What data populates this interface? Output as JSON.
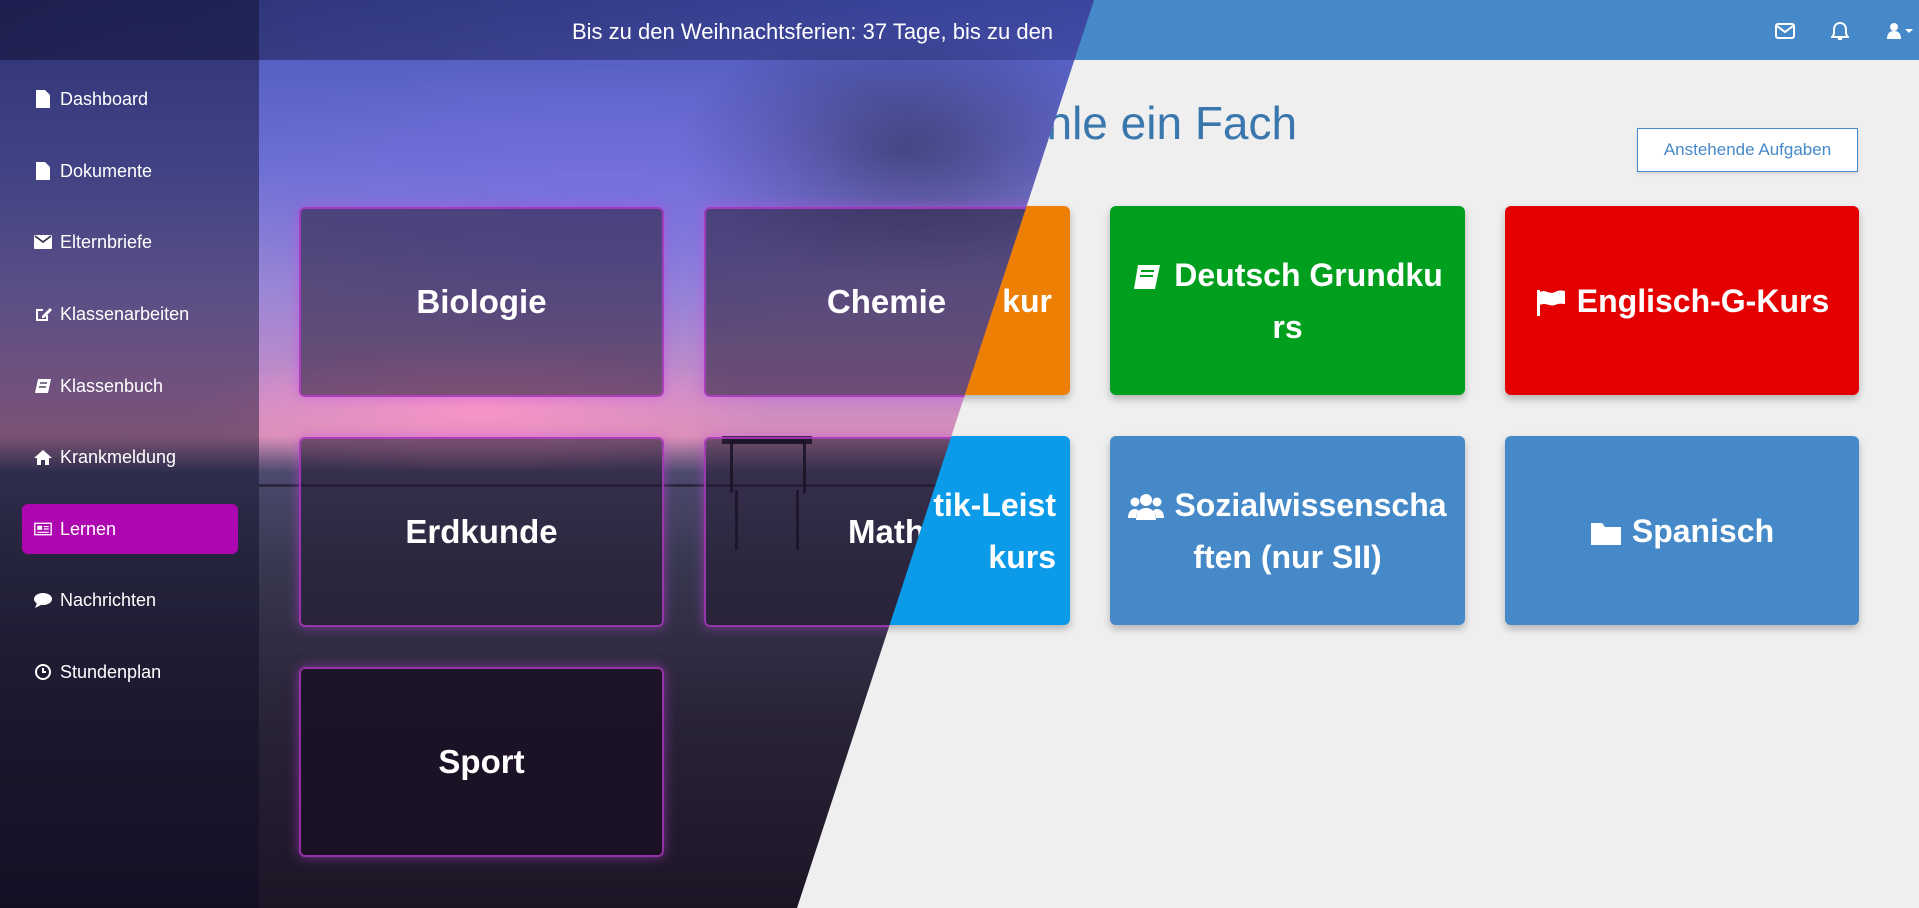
{
  "header": {
    "announcement": "Bis zu den Weihnachtsferien: 37 Tage, bis zu den"
  },
  "sidebar": {
    "items": [
      {
        "label": "Dashboard",
        "icon": "file-icon"
      },
      {
        "label": "Dokumente",
        "icon": "file-icon"
      },
      {
        "label": "Elternbriefe",
        "icon": "envelope-icon"
      },
      {
        "label": "Klassenarbeiten",
        "icon": "edit-icon"
      },
      {
        "label": "Klassenbuch",
        "icon": "book-icon"
      },
      {
        "label": "Krankmeldung",
        "icon": "home-icon"
      },
      {
        "label": "Lernen",
        "icon": "newspaper-icon",
        "active": true
      },
      {
        "label": "Nachrichten",
        "icon": "comment-icon"
      },
      {
        "label": "Stundenplan",
        "icon": "clock-icon"
      }
    ],
    "active_color": "#ae06b0"
  },
  "main": {
    "title": "Bitte wähle ein Fach",
    "tasks_button": "Anstehende Aufgaben"
  },
  "subjects_dark": [
    {
      "label": "Biologie"
    },
    {
      "label": "Chemie"
    },
    {
      "label": "Erdkunde"
    },
    {
      "label": "Math"
    },
    {
      "label": "Sport"
    }
  ],
  "subjects_flat": [
    {
      "label": "kur",
      "color": "#ed7f05"
    },
    {
      "label": "Deutsch Grundku rs",
      "color": "#00a01e",
      "icon": "book-icon"
    },
    {
      "label": "Englisch-G-Kurs",
      "color": "#e40000",
      "icon": "flag-icon"
    },
    {
      "label": "tik-Leist kurs",
      "color": "#0b9be8"
    },
    {
      "label": "Sozialwissenscha ften (nur SII)",
      "color": "#4689c9",
      "icon": "users-icon"
    },
    {
      "label": "Spanisch",
      "color": "#4689c9",
      "icon": "folder-icon"
    }
  ],
  "colors": {
    "topbar": "#4689c9",
    "title": "#3a77ad",
    "background": "#efefef"
  }
}
